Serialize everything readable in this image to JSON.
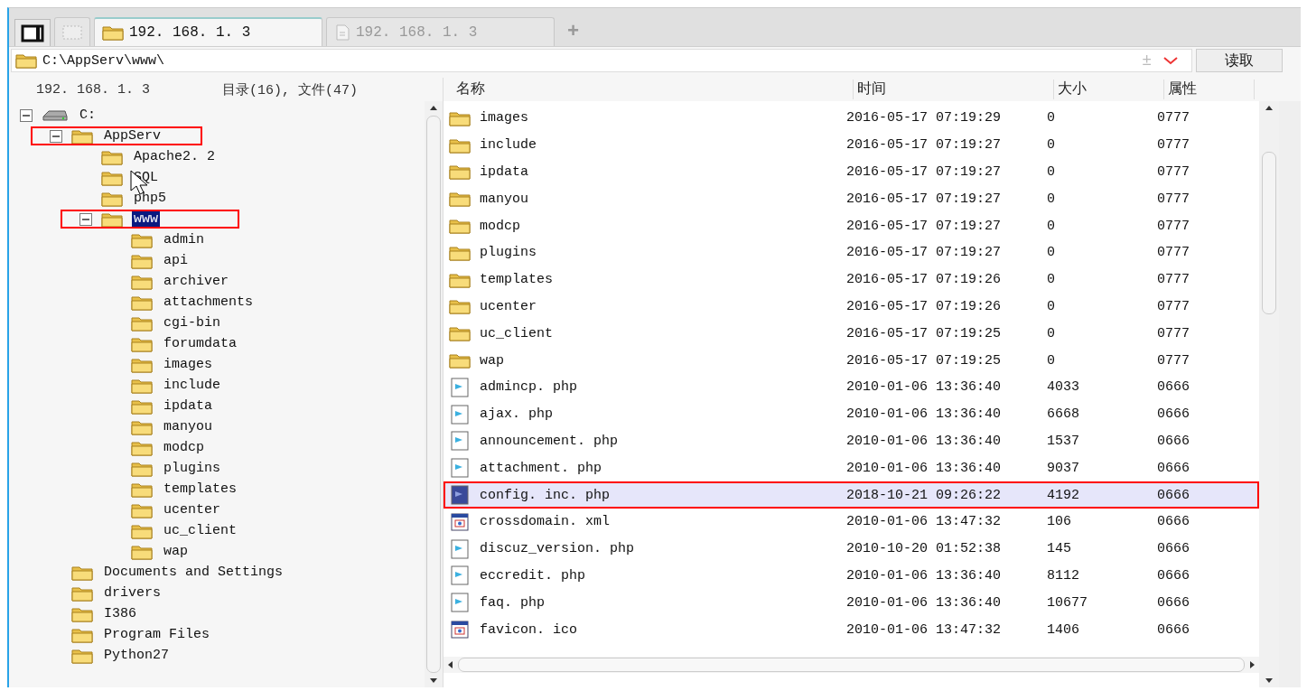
{
  "tabs": [
    {
      "kind": "layout"
    },
    {
      "kind": "blank",
      "selected": false
    },
    {
      "kind": "folder",
      "label": "192. 168. 1. 3",
      "selected": true
    },
    {
      "kind": "document",
      "label": "192. 168. 1. 3",
      "selected": false
    }
  ],
  "new_tab": "+",
  "address": {
    "path": "C:\\AppServ\\www\\",
    "toggle": "±",
    "button": "读取"
  },
  "tree_header": {
    "host": "192. 168. 1. 3",
    "summary": "目录(16), 文件(47)"
  },
  "tree": [
    {
      "label": "C:",
      "kind": "drive",
      "expanded": true,
      "selected": false,
      "annotated": false,
      "children": [
        {
          "label": "AppServ",
          "kind": "folder",
          "expanded": true,
          "selected": false,
          "annotated": true,
          "children": [
            {
              "label": "Apache2. 2",
              "kind": "folder",
              "selected": false,
              "annotated": false
            },
            {
              "label": "SQL",
              "kind": "folder",
              "selected": false,
              "annotated": false,
              "cursor": true
            },
            {
              "label": "php5",
              "kind": "folder",
              "selected": false,
              "annotated": false
            },
            {
              "label": "www",
              "kind": "folder",
              "expanded": true,
              "selected": true,
              "annotated": true,
              "children": [
                {
                  "label": "admin",
                  "kind": "folder",
                  "selected": false,
                  "annotated": false
                },
                {
                  "label": "api",
                  "kind": "folder",
                  "selected": false,
                  "annotated": false
                },
                {
                  "label": "archiver",
                  "kind": "folder",
                  "selected": false,
                  "annotated": false
                },
                {
                  "label": "attachments",
                  "kind": "folder",
                  "selected": false,
                  "annotated": false
                },
                {
                  "label": "cgi-bin",
                  "kind": "folder",
                  "selected": false,
                  "annotated": false
                },
                {
                  "label": "forumdata",
                  "kind": "folder",
                  "selected": false,
                  "annotated": false
                },
                {
                  "label": "images",
                  "kind": "folder",
                  "selected": false,
                  "annotated": false
                },
                {
                  "label": "include",
                  "kind": "folder",
                  "selected": false,
                  "annotated": false
                },
                {
                  "label": "ipdata",
                  "kind": "folder",
                  "selected": false,
                  "annotated": false
                },
                {
                  "label": "manyou",
                  "kind": "folder",
                  "selected": false,
                  "annotated": false
                },
                {
                  "label": "modcp",
                  "kind": "folder",
                  "selected": false,
                  "annotated": false
                },
                {
                  "label": "plugins",
                  "kind": "folder",
                  "selected": false,
                  "annotated": false
                },
                {
                  "label": "templates",
                  "kind": "folder",
                  "selected": false,
                  "annotated": false
                },
                {
                  "label": "ucenter",
                  "kind": "folder",
                  "selected": false,
                  "annotated": false
                },
                {
                  "label": "uc_client",
                  "kind": "folder",
                  "selected": false,
                  "annotated": false
                },
                {
                  "label": "wap",
                  "kind": "folder",
                  "selected": false,
                  "annotated": false
                }
              ]
            }
          ]
        },
        {
          "label": "Documents and Settings",
          "kind": "folder",
          "selected": false,
          "annotated": false
        },
        {
          "label": "drivers",
          "kind": "folder",
          "selected": false,
          "annotated": false
        },
        {
          "label": "I386",
          "kind": "folder",
          "selected": false,
          "annotated": false
        },
        {
          "label": "Program Files",
          "kind": "folder",
          "selected": false,
          "annotated": false
        },
        {
          "label": "Python27",
          "kind": "folder",
          "selected": false,
          "annotated": false
        }
      ]
    }
  ],
  "table": {
    "columns": [
      "名称",
      "时间",
      "大小",
      "属性"
    ],
    "rows": [
      {
        "kind": "folder",
        "name": "images",
        "time": "2016-05-17 07:19:29",
        "size": "0",
        "attr": "0777",
        "selected": false,
        "annotated": false
      },
      {
        "kind": "folder",
        "name": "include",
        "time": "2016-05-17 07:19:27",
        "size": "0",
        "attr": "0777",
        "selected": false,
        "annotated": false
      },
      {
        "kind": "folder",
        "name": "ipdata",
        "time": "2016-05-17 07:19:27",
        "size": "0",
        "attr": "0777",
        "selected": false,
        "annotated": false
      },
      {
        "kind": "folder",
        "name": "manyou",
        "time": "2016-05-17 07:19:27",
        "size": "0",
        "attr": "0777",
        "selected": false,
        "annotated": false
      },
      {
        "kind": "folder",
        "name": "modcp",
        "time": "2016-05-17 07:19:27",
        "size": "0",
        "attr": "0777",
        "selected": false,
        "annotated": false
      },
      {
        "kind": "folder",
        "name": "plugins",
        "time": "2016-05-17 07:19:27",
        "size": "0",
        "attr": "0777",
        "selected": false,
        "annotated": false
      },
      {
        "kind": "folder",
        "name": "templates",
        "time": "2016-05-17 07:19:26",
        "size": "0",
        "attr": "0777",
        "selected": false,
        "annotated": false
      },
      {
        "kind": "folder",
        "name": "ucenter",
        "time": "2016-05-17 07:19:26",
        "size": "0",
        "attr": "0777",
        "selected": false,
        "annotated": false
      },
      {
        "kind": "folder",
        "name": "uc_client",
        "time": "2016-05-17 07:19:25",
        "size": "0",
        "attr": "0777",
        "selected": false,
        "annotated": false
      },
      {
        "kind": "folder",
        "name": "wap",
        "time": "2016-05-17 07:19:25",
        "size": "0",
        "attr": "0777",
        "selected": false,
        "annotated": false
      },
      {
        "kind": "script",
        "name": "admincp. php",
        "time": "2010-01-06 13:36:40",
        "size": "4033",
        "attr": "0666",
        "selected": false,
        "annotated": false
      },
      {
        "kind": "script",
        "name": "ajax. php",
        "time": "2010-01-06 13:36:40",
        "size": "6668",
        "attr": "0666",
        "selected": false,
        "annotated": false
      },
      {
        "kind": "script",
        "name": "announcement. php",
        "time": "2010-01-06 13:36:40",
        "size": "1537",
        "attr": "0666",
        "selected": false,
        "annotated": false
      },
      {
        "kind": "script",
        "name": "attachment. php",
        "time": "2010-01-06 13:36:40",
        "size": "9037",
        "attr": "0666",
        "selected": false,
        "annotated": false
      },
      {
        "kind": "script",
        "name": "config. inc. php",
        "time": "2018-10-21 09:26:22",
        "size": "4192",
        "attr": "0666",
        "selected": true,
        "annotated": true
      },
      {
        "kind": "webpage",
        "name": "crossdomain. xml",
        "time": "2010-01-06 13:47:32",
        "size": "106",
        "attr": "0666",
        "selected": false,
        "annotated": false
      },
      {
        "kind": "script",
        "name": "discuz_version. php",
        "time": "2010-10-20 01:52:38",
        "size": "145",
        "attr": "0666",
        "selected": false,
        "annotated": false
      },
      {
        "kind": "script",
        "name": "eccredit. php",
        "time": "2010-01-06 13:36:40",
        "size": "8112",
        "attr": "0666",
        "selected": false,
        "annotated": false
      },
      {
        "kind": "script",
        "name": "faq. php",
        "time": "2010-01-06 13:36:40",
        "size": "10677",
        "attr": "0666",
        "selected": false,
        "annotated": false
      },
      {
        "kind": "webpage",
        "name": "favicon. ico",
        "time": "2010-01-06 13:47:32",
        "size": "1406",
        "attr": "0666",
        "selected": false,
        "annotated": false
      }
    ]
  }
}
